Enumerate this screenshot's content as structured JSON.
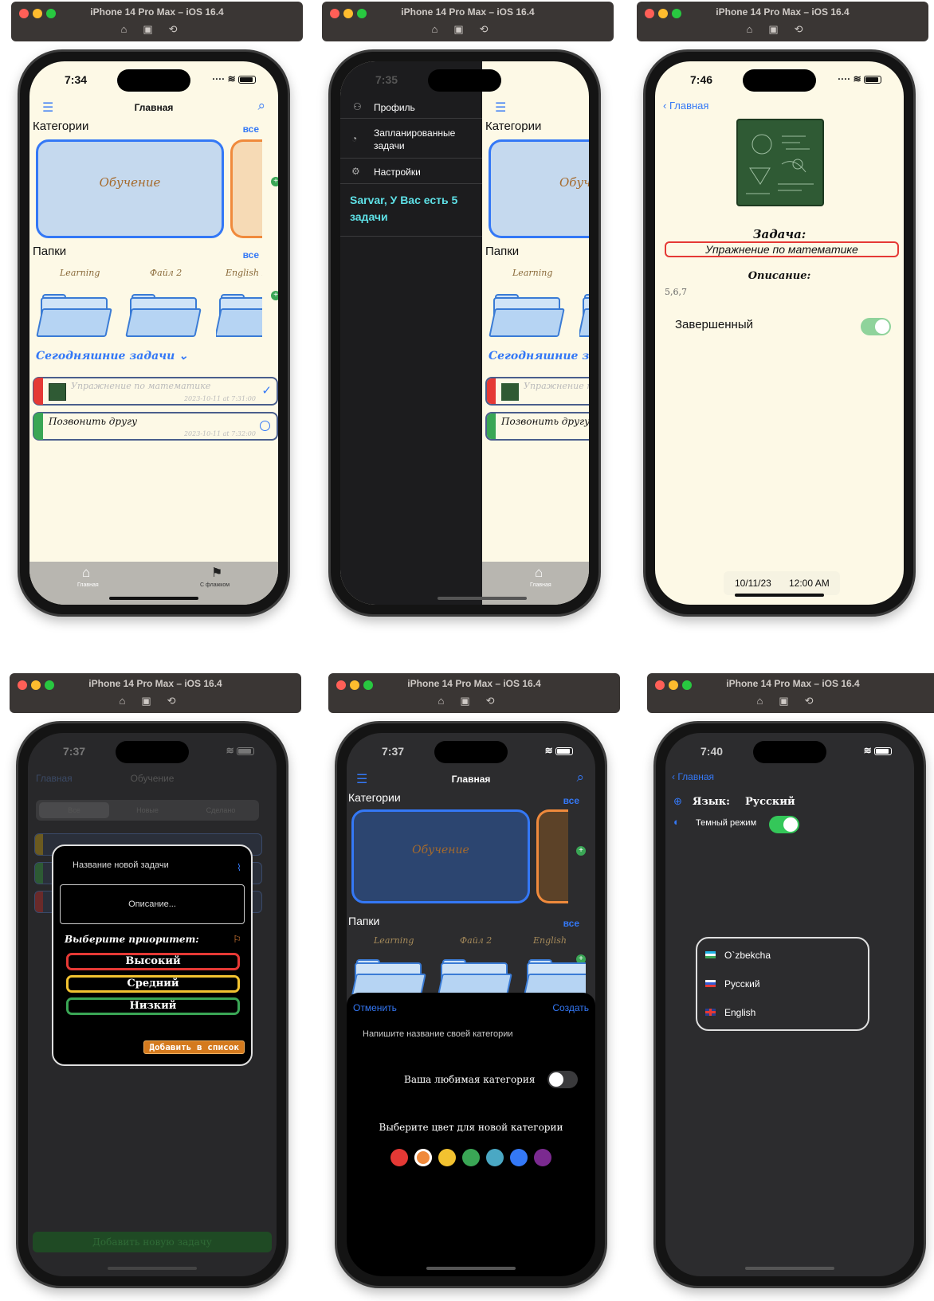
{
  "window_title": "iPhone 14 Pro Max – iOS 16.4",
  "toolbar_icons": [
    "home-icon",
    "screenshot-icon",
    "rotate-icon"
  ],
  "screens": {
    "home": {
      "time": "7:34",
      "nav_title": "Главная",
      "categories_label": "Категории",
      "see_all": "все",
      "category_name": "Обучение",
      "folders_label": "Папки",
      "folder_names": [
        "Learning",
        "Файл 2",
        "English le"
      ],
      "today_label": "Сегодняшние задачи ⌄",
      "tasks": [
        {
          "title": "Упражнение по математике",
          "date": "2023-10-11 at 7:31:00"
        },
        {
          "title": "Позвонить другу",
          "date": "2023-10-11 at 7:32:00"
        }
      ],
      "tab_home": "Главная",
      "tab_flag": "С флажком"
    },
    "menu": {
      "time": "7:35",
      "items": [
        "Профиль",
        "Запланированные задачи",
        "Настройки"
      ],
      "greeting": "Sarvar, У Вас есть 5 задачи",
      "categories_label": "Категории",
      "category_name": "Обучен",
      "folders_label": "Папки",
      "folder_name": "Learning",
      "today_label": "Сегодняшние зад",
      "task1": "Упражнение по",
      "task2": "Позвонить другу",
      "tab_home": "Главная"
    },
    "detail": {
      "time": "7:46",
      "back": "Главная",
      "task_label": "Задача:",
      "task_title": "Упражнение по математике",
      "description_label": "Описание:",
      "description": "5,6,7",
      "completed_label": "Завершенный",
      "completed": true,
      "date": "10/11/23",
      "clock": "12:00 AM"
    },
    "new_task": {
      "time": "7:37",
      "nav_back": "Главная",
      "nav_title": "Обучение",
      "segments": [
        "Все",
        "Новые",
        "Сделано"
      ],
      "bg_task": "Название новой задачи",
      "name_placeholder": "Название новой задачи",
      "description_placeholder": "Описание...",
      "priority_label": "Выберите приоритет:",
      "priorities": [
        "Высокий",
        "Средний",
        "Низкий"
      ],
      "priority_colors": [
        "#e53935",
        "#f2c230",
        "#3aa655"
      ],
      "add_button": "Добавить  в  список",
      "bottom_button": "Добавить новую задачу"
    },
    "new_category": {
      "time": "7:37",
      "nav_title": "Главная",
      "categories_label": "Категории",
      "see_all": "все",
      "category_name": "Обучение",
      "folders_label": "Папки",
      "folder_names": [
        "Learning",
        "Файл 2",
        "English le"
      ],
      "cancel": "Отменить",
      "create": "Создать",
      "name_placeholder": "Напишите название своей категории",
      "favorite_label": "Ваша любимая категория",
      "favorite": false,
      "color_label": "Выберите цвет для новой категории",
      "colors": [
        "#e53935",
        "#f08a3c",
        "#f2c230",
        "#3aa655",
        "#4aa8c4",
        "#3478f6",
        "#7b2a90"
      ],
      "selected_color_index": 1
    },
    "settings": {
      "time": "7:40",
      "back": "Главная",
      "language_label": "Язык:",
      "language_value": "Русский",
      "dark_mode_label": "Темный режим",
      "dark_mode": true,
      "languages": [
        {
          "flag": "uz-flag-icon",
          "name": "O`zbekcha"
        },
        {
          "flag": "ru-flag-icon",
          "name": "Русский"
        },
        {
          "flag": "gb-flag-icon",
          "name": "English"
        }
      ]
    }
  }
}
